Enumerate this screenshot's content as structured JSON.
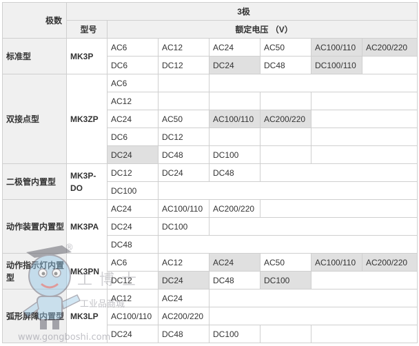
{
  "header": {
    "poles_label": "极数",
    "poles_value": "3极",
    "model_label": "型号",
    "voltage_label": "额定电压 （V）"
  },
  "groups": [
    {
      "category": "标准型",
      "model": "MK3P",
      "rows": [
        [
          "AC6",
          "AC12",
          "AC24",
          "AC50",
          "AC100/110",
          "AC200/220"
        ],
        [
          "DC6",
          "DC12",
          "DC24",
          "DC48",
          "DC100/110"
        ]
      ]
    },
    {
      "category": "双接点型",
      "model": "MK3ZP",
      "rows": [
        [
          "AC6"
        ],
        [
          "AC12"
        ],
        [
          "AC24",
          "AC50",
          "AC100/110",
          "AC200/220"
        ],
        [
          "DC6",
          "DC12"
        ],
        [
          "DC24",
          "DC48",
          "DC100"
        ]
      ]
    },
    {
      "category": "二极管内置型",
      "model": "MK3P-DO",
      "rows": [
        [
          "DC12",
          "DC24",
          "DC48"
        ],
        [
          "DC100"
        ]
      ]
    },
    {
      "category": "动作装置内置型",
      "model": "MK3PA",
      "rows": [
        [
          "AC24",
          "AC100/110",
          "AC200/220"
        ],
        [
          "DC24",
          "DC100"
        ],
        [
          "DC48"
        ]
      ]
    },
    {
      "category": "动作指示灯内置型",
      "model": "MK3PN",
      "rows": [
        [
          "AC6",
          "AC12",
          "AC24",
          "AC50",
          "AC100/110",
          "AC200/220"
        ],
        [
          "DC12",
          "DC24",
          "DC48",
          "DC100"
        ]
      ]
    },
    {
      "category": "弧形屏障内置型",
      "model": "MK3LP",
      "rows": [
        [
          "AC12",
          "AC24"
        ],
        [
          "AC100/110",
          "AC200/220"
        ],
        [
          "DC24",
          "DC48",
          "DC100"
        ]
      ]
    }
  ],
  "watermark": {
    "registered_mark": "®",
    "brand_chars": "工博士",
    "brand_sub": "工业品商城",
    "url": "www.gongboshi.com"
  },
  "colors": {
    "header_bg": "#f0f0f0",
    "highlight_bg": "#e0e0e0",
    "border": "#cfcfcf",
    "text": "#333333"
  }
}
